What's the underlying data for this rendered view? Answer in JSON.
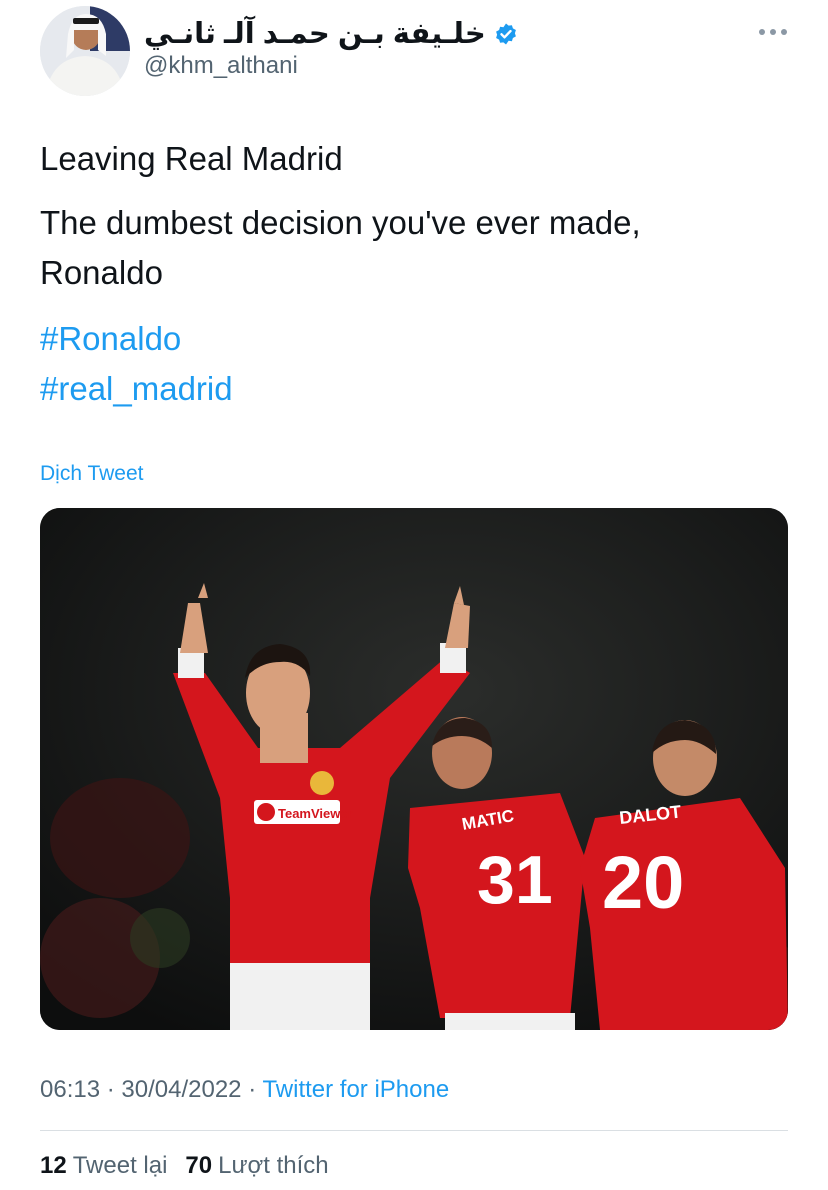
{
  "author": {
    "display_name": "خلـيفة بـن حمـد آلـ ثانـي",
    "handle": "@khm_althani",
    "verified": true,
    "avatar_icon": "profile-photo"
  },
  "tweet": {
    "line1": "Leaving Real Madrid",
    "line2": "The dumbest decision you've ever made, Ronaldo",
    "hashtags": [
      "#Ronaldo",
      "#real_madrid"
    ],
    "translate_label": "Dịch Tweet"
  },
  "media": {
    "jersey_31_name": "MATIC",
    "jersey_31_number": "31",
    "jersey_20_name": "DALOT",
    "jersey_20_number": "20",
    "sponsor": "TeamViewer"
  },
  "meta": {
    "time": "06:13",
    "date": "30/04/2022",
    "source": "Twitter for iPhone",
    "separator": "·"
  },
  "stats": {
    "retweets_count": "12",
    "retweets_label": "Tweet lại",
    "likes_count": "70",
    "likes_label": "Lượt thích"
  },
  "colors": {
    "link": "#1d9bf0",
    "text": "#0f1419",
    "muted": "#536471",
    "kit_red": "#d4161d"
  }
}
